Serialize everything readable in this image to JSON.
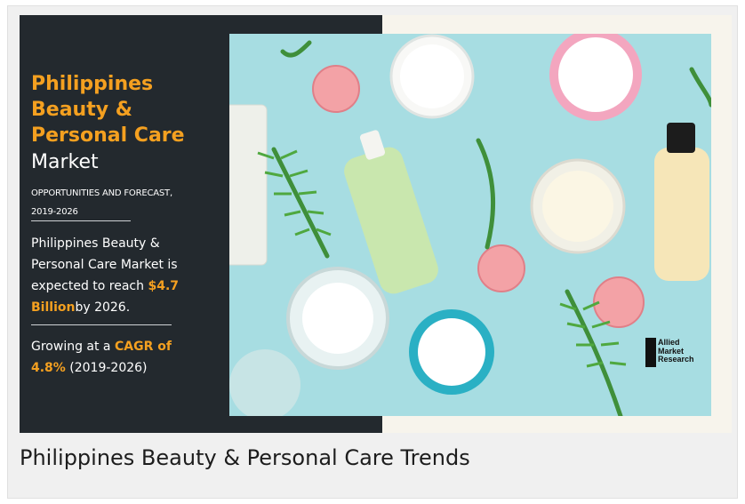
{
  "banner": {
    "title_lines": [
      "Philippines",
      "Beauty &",
      "Personal Care"
    ],
    "title_market": "Market",
    "subtitle_line1": "OPPORTUNITIES AND FORECAST,",
    "subtitle_line2": "2019-2026",
    "body1_before": "Philippines Beauty & Personal Care Market is expected to reach ",
    "body1_highlight": "$4.7 Billion",
    "body1_after": "by 2026.",
    "body2_before": "Growing at a ",
    "body2_highlight": "CAGR of 4.8%",
    "body2_after": " (2019-2026)"
  },
  "logo": {
    "lines": [
      "Allied",
      "Market",
      "Research"
    ]
  },
  "caption": "Philippines Beauty & Personal Care Trends",
  "colors": {
    "banner_bg": "#23292e",
    "accent": "#f4a020",
    "photo_bg": "#a7dde2"
  }
}
